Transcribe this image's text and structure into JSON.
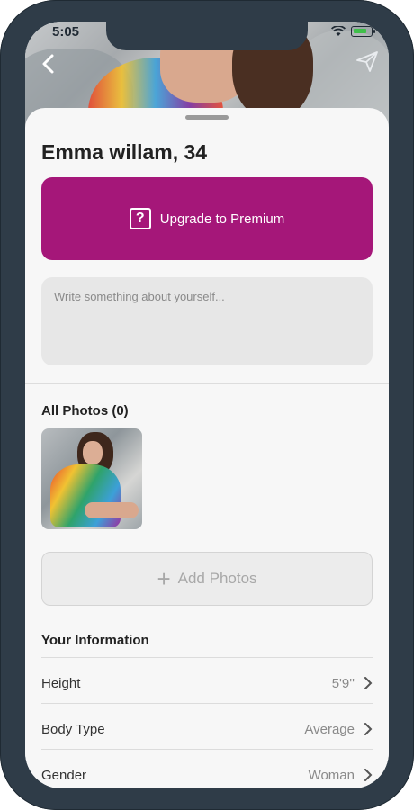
{
  "status_bar": {
    "time": "5:05"
  },
  "profile": {
    "name_age": "Emma willam, 34"
  },
  "premium": {
    "label": "Upgrade to Premium",
    "icon": "question-box-icon",
    "color": "#a51779"
  },
  "about": {
    "placeholder": "Write something about yourself...",
    "value": ""
  },
  "photos": {
    "title": "All Photos (0)",
    "add_label": "Add Photos"
  },
  "info": {
    "title": "Your Information",
    "rows": [
      {
        "label": "Height",
        "value": "5'9''"
      },
      {
        "label": "Body Type",
        "value": "Average"
      },
      {
        "label": "Gender",
        "value": "Woman"
      }
    ]
  }
}
